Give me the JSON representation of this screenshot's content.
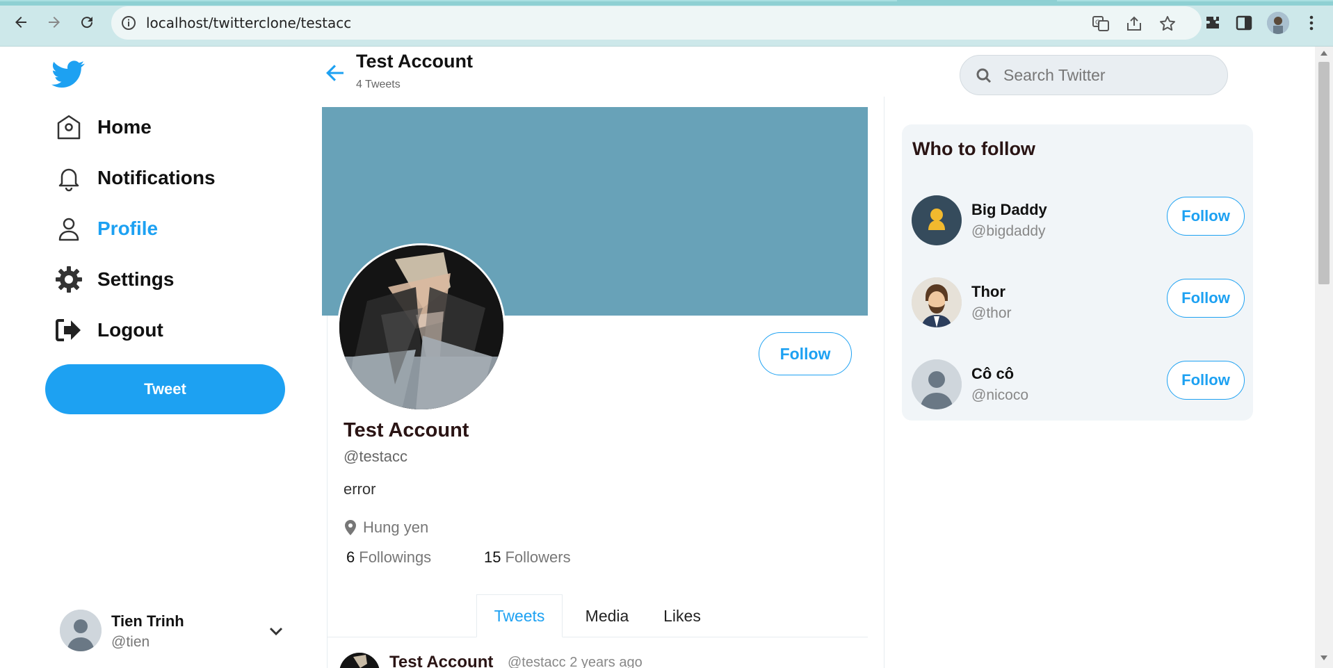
{
  "browser": {
    "url": "localhost/twitterclone/testacc"
  },
  "sidebar": {
    "items": [
      {
        "label": "Home",
        "icon": "home-icon"
      },
      {
        "label": "Notifications",
        "icon": "bell-icon"
      },
      {
        "label": "Profile",
        "icon": "profile-icon",
        "active": true
      },
      {
        "label": "Settings",
        "icon": "gear-icon"
      },
      {
        "label": "Logout",
        "icon": "logout-icon"
      }
    ],
    "tweet_button": "Tweet",
    "account": {
      "name": "Tien Trinh",
      "handle": "@tien"
    }
  },
  "header": {
    "title": "Test Account",
    "tweet_count": "4 Tweets"
  },
  "profile": {
    "name": "Test Account",
    "handle": "@testacc",
    "bio": "error",
    "location": "Hung yen",
    "followings_count": "6",
    "followings_label": "Followings",
    "followers_count": "15",
    "followers_label": "Followers",
    "follow_button": "Follow",
    "banner_color": "#68a2b8"
  },
  "tabs": [
    {
      "label": "Tweets",
      "active": true
    },
    {
      "label": "Media"
    },
    {
      "label": "Likes"
    }
  ],
  "tweet_preview": {
    "name": "Test Account",
    "meta": "@testacc 2 years ago"
  },
  "search": {
    "placeholder": "Search Twitter"
  },
  "who_to_follow": {
    "title": "Who to follow",
    "users": [
      {
        "name": "Big Daddy",
        "handle": "@bigdaddy",
        "button": "Follow"
      },
      {
        "name": "Thor",
        "handle": "@thor",
        "button": "Follow"
      },
      {
        "name": "Cô cô",
        "handle": "@nicoco",
        "button": "Follow"
      }
    ]
  },
  "colors": {
    "accent": "#1da1f2",
    "banner": "#68a2b8"
  }
}
